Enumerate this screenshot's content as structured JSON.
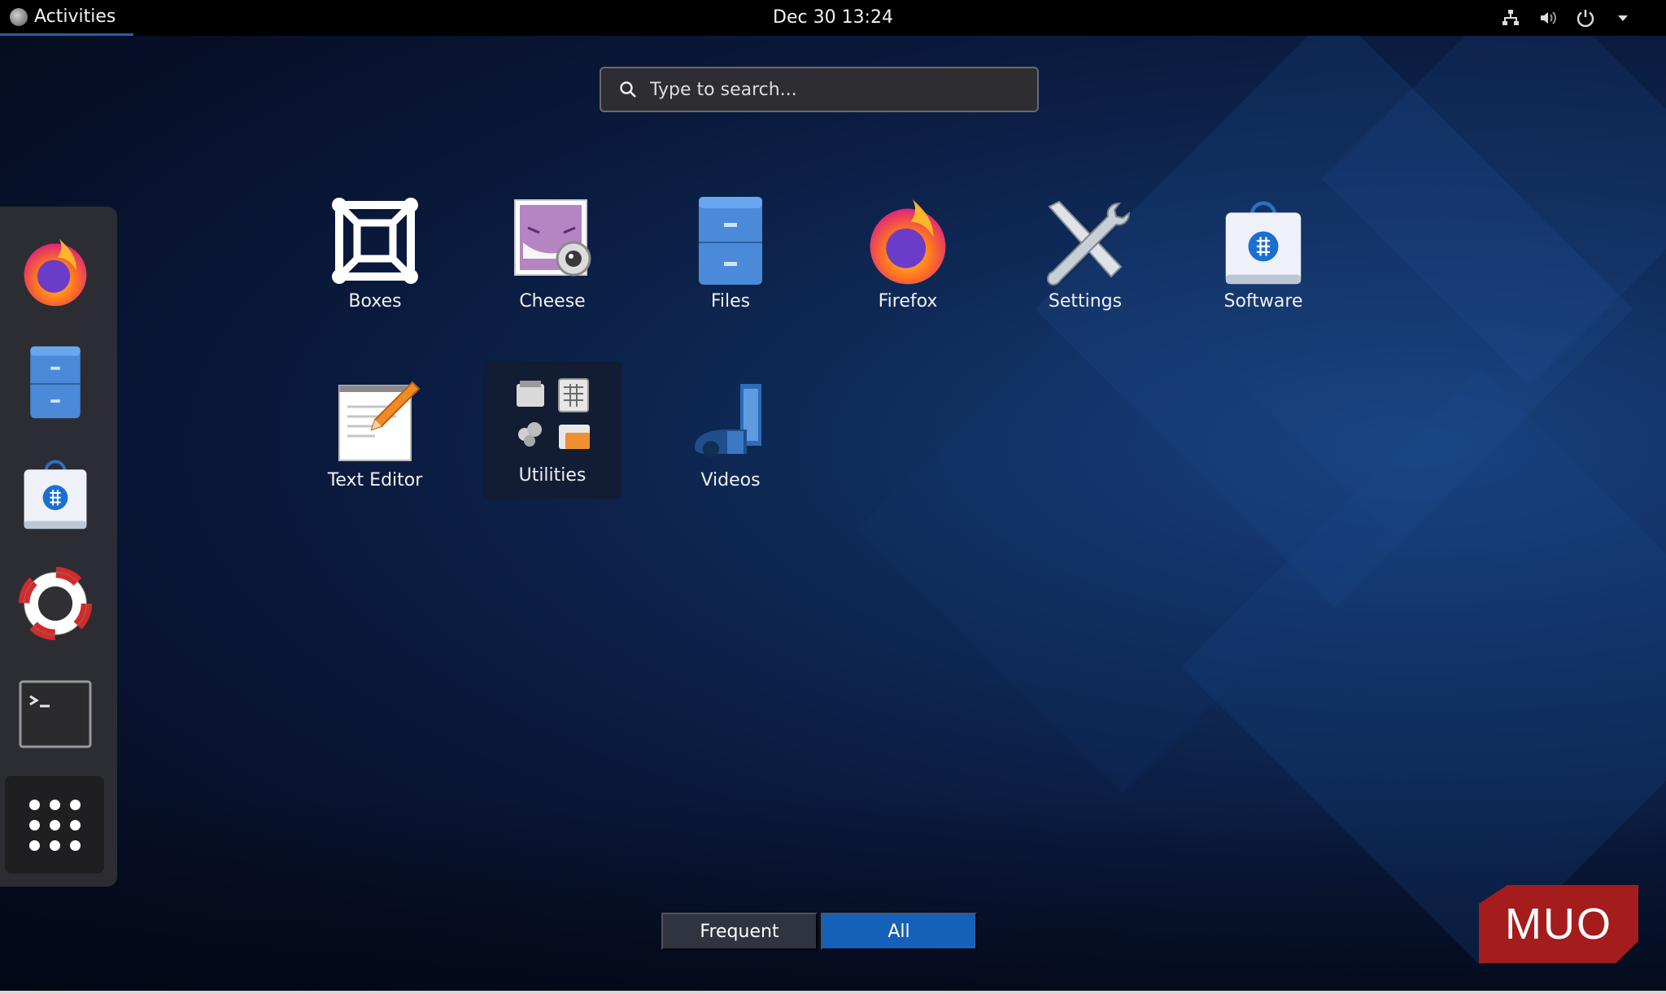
{
  "topbar": {
    "activities_label": "Activities",
    "clock": "Dec 30  13:24",
    "indicators": [
      "network-icon",
      "volume-icon",
      "power-icon",
      "chevron-down-icon"
    ]
  },
  "search": {
    "placeholder": "Type to search..."
  },
  "dash": {
    "items": [
      {
        "name": "Firefox",
        "icon": "firefox-icon"
      },
      {
        "name": "Files",
        "icon": "files-icon"
      },
      {
        "name": "Software",
        "icon": "software-icon"
      },
      {
        "name": "Help",
        "icon": "help-icon"
      },
      {
        "name": "Terminal",
        "icon": "terminal-icon"
      },
      {
        "name": "Show Applications",
        "icon": "app-grid-icon"
      }
    ]
  },
  "apps": [
    {
      "label": "Boxes",
      "icon": "boxes-icon"
    },
    {
      "label": "Cheese",
      "icon": "cheese-icon"
    },
    {
      "label": "Files",
      "icon": "files-icon"
    },
    {
      "label": "Firefox",
      "icon": "firefox-icon"
    },
    {
      "label": "Settings",
      "icon": "settings-icon"
    },
    {
      "label": "Software",
      "icon": "software-icon"
    },
    {
      "label": "Text Editor",
      "icon": "text-editor-icon"
    },
    {
      "label": "Utilities",
      "icon": "utilities-folder-icon"
    },
    {
      "label": "Videos",
      "icon": "videos-icon"
    }
  ],
  "view_toggle": {
    "frequent_label": "Frequent",
    "all_label": "All",
    "active": "All"
  },
  "watermark": "MUO",
  "colors": {
    "accent": "#1560b8",
    "topbar": "#000000",
    "watermark": "#a51c1c"
  }
}
